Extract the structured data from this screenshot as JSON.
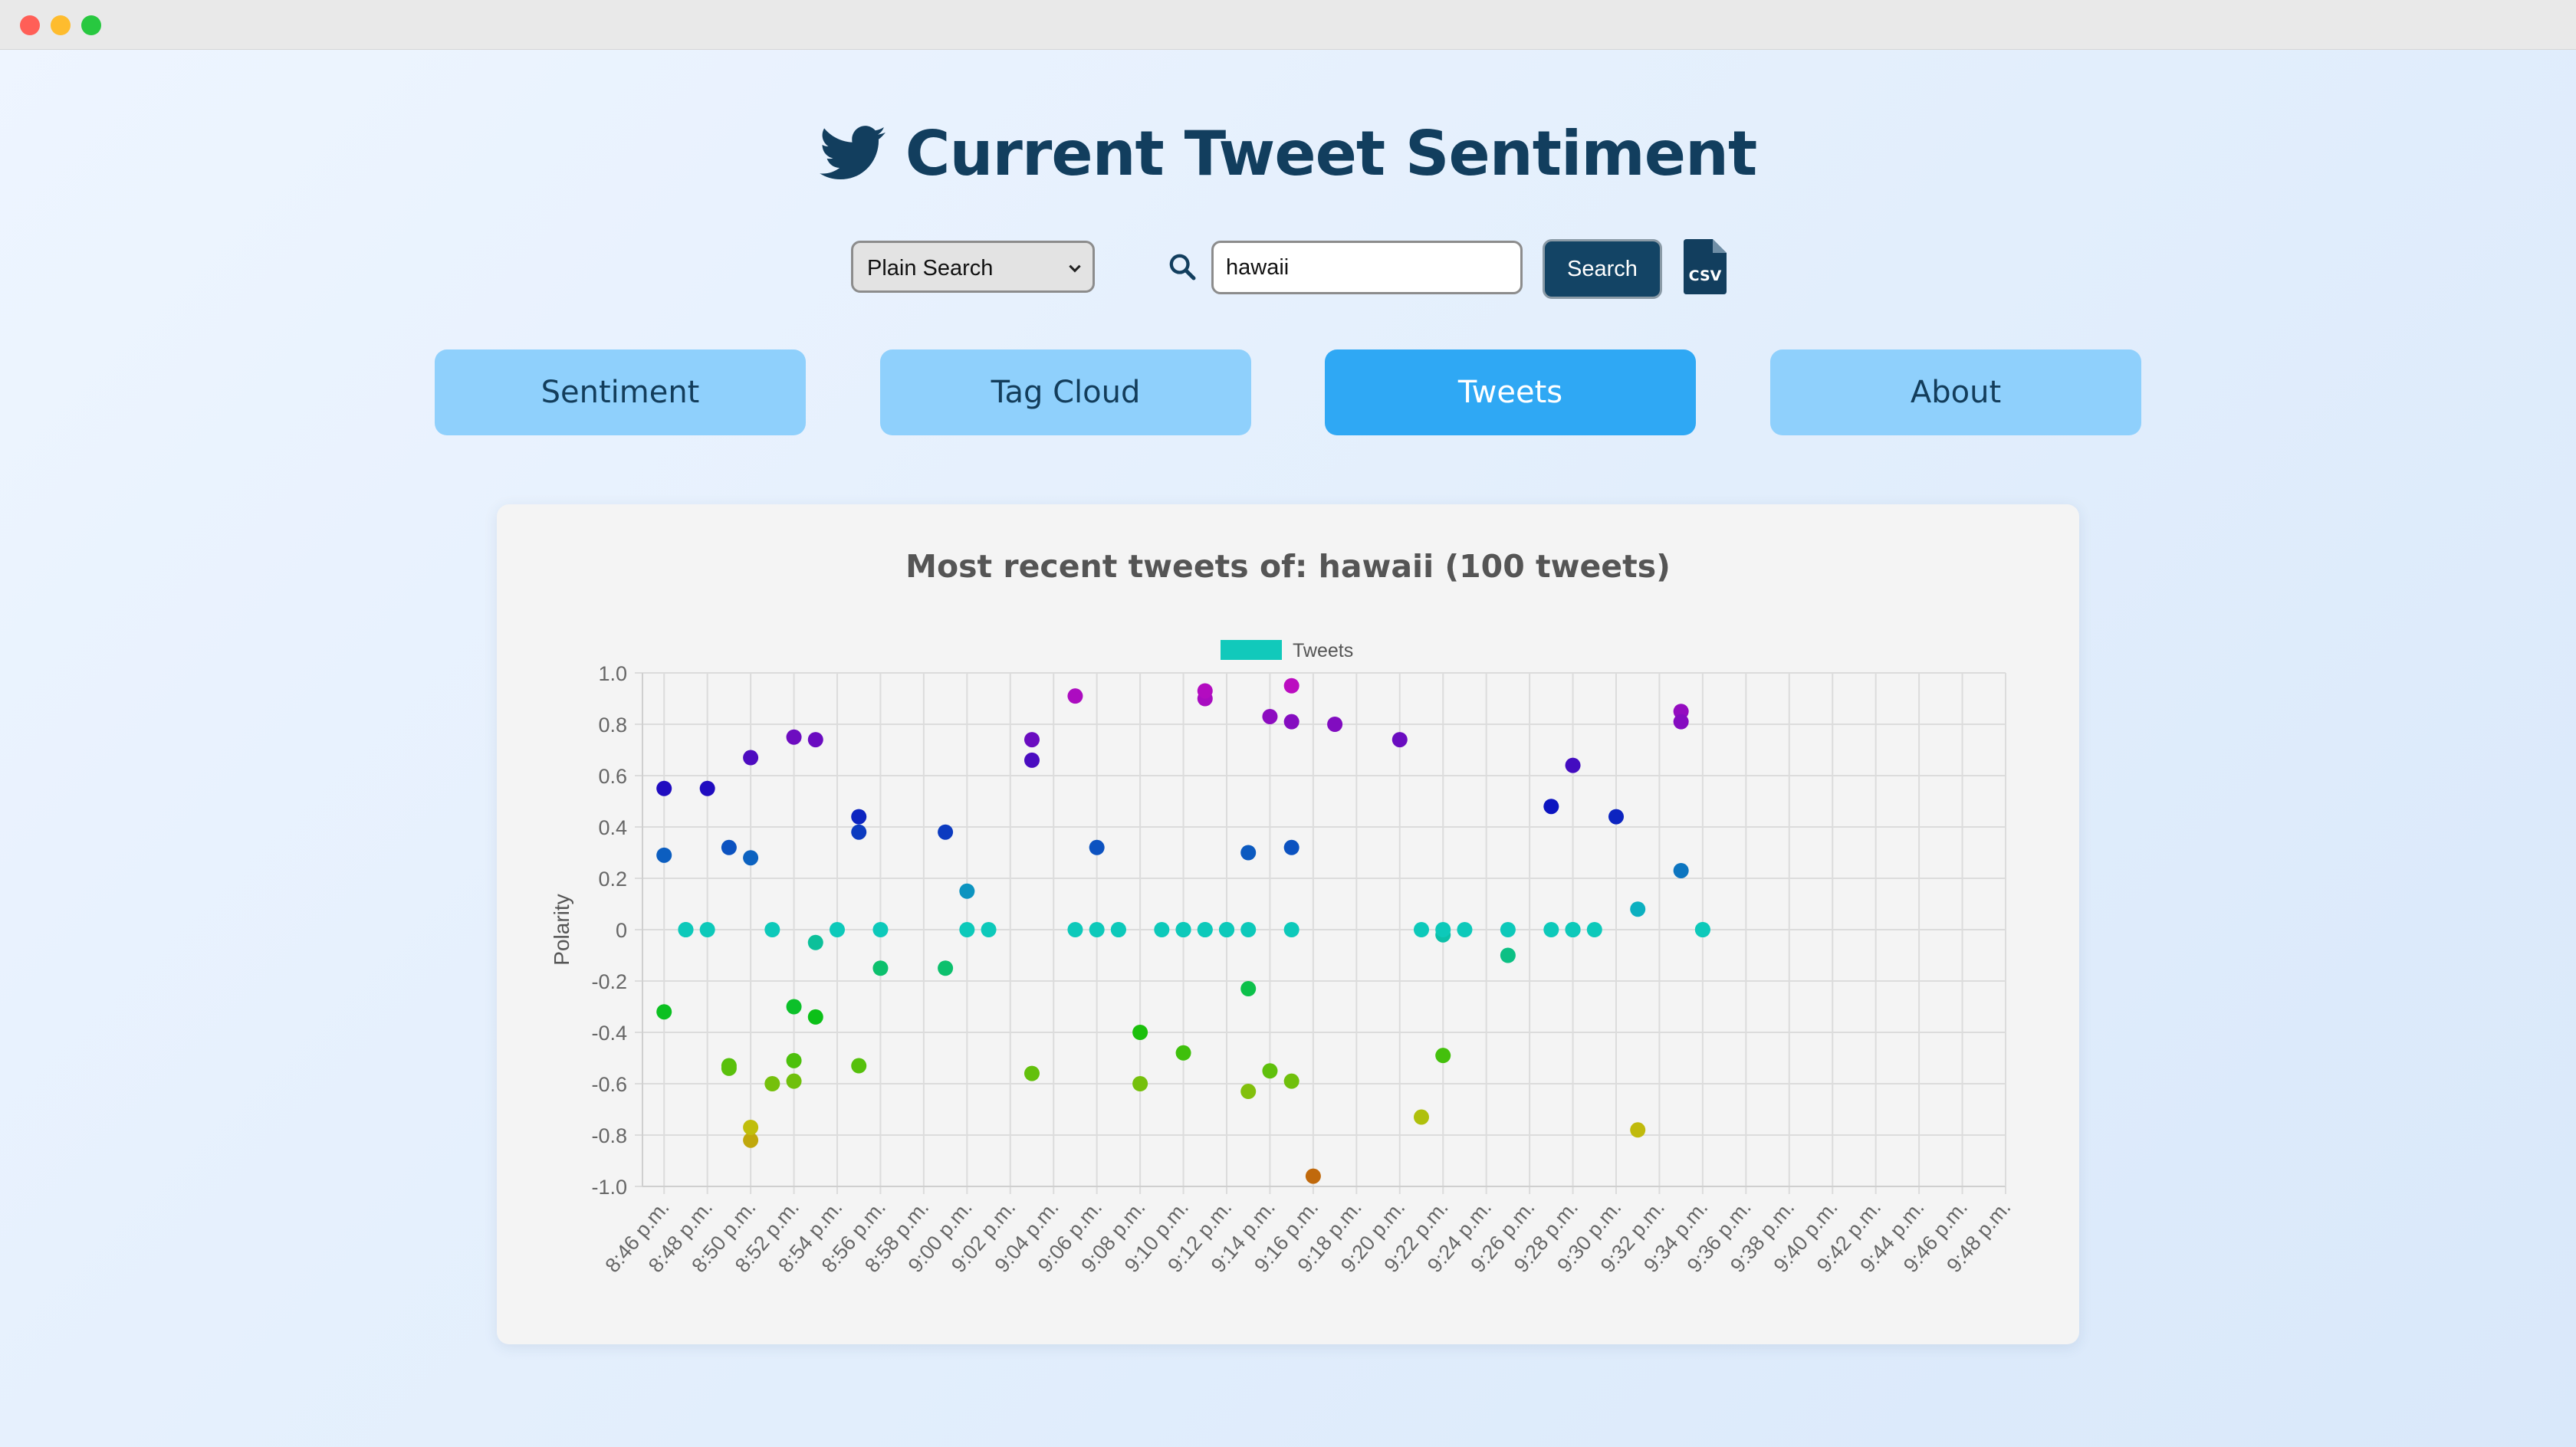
{
  "app": {
    "title": "Current Tweet Sentiment"
  },
  "search": {
    "mode_selected": "Plain Search",
    "query": "hawaii",
    "button_label": "Search",
    "export_icon": "csv-file-icon"
  },
  "nav": {
    "tabs": [
      {
        "label": "Sentiment",
        "active": false
      },
      {
        "label": "Tag Cloud",
        "active": false
      },
      {
        "label": "Tweets",
        "active": true
      },
      {
        "label": "About",
        "active": false
      }
    ]
  },
  "colors": {
    "title": "#123e5e",
    "active_tab": "#2fa8f4",
    "inactive_tab": "#8fd0fc",
    "legend_swatch": "#11c9bb"
  },
  "chart_data": {
    "type": "scatter",
    "title": "Most recent tweets of: hawaii (100 tweets)",
    "legend": [
      "Tweets"
    ],
    "legend_position": "top",
    "ylabel": "Polarity",
    "ylim": [
      -1.0,
      1.0
    ],
    "y_ticks": [
      "1.0",
      "0.8",
      "0.6",
      "0.4",
      "0.2",
      "0",
      "-0.2",
      "-0.4",
      "-0.6",
      "-0.8",
      "-1.0"
    ],
    "x_ticks": [
      "8:46 p.m.",
      "8:48 p.m.",
      "8:50 p.m.",
      "8:52 p.m.",
      "8:54 p.m.",
      "8:56 p.m.",
      "8:58 p.m.",
      "9:00 p.m.",
      "9:02 p.m.",
      "9:04 p.m.",
      "9:06 p.m.",
      "9:08 p.m.",
      "9:10 p.m.",
      "9:12 p.m.",
      "9:14 p.m.",
      "9:16 p.m.",
      "9:18 p.m.",
      "9:20 p.m.",
      "9:22 p.m.",
      "9:24 p.m.",
      "9:26 p.m.",
      "9:28 p.m.",
      "9:30 p.m.",
      "9:32 p.m.",
      "9:34 p.m.",
      "9:36 p.m.",
      "9:38 p.m.",
      "9:40 p.m.",
      "9:42 p.m.",
      "9:44 p.m.",
      "9:46 p.m.",
      "9:48 p.m."
    ],
    "x_range_minutes": [
      "8:45 p.m.",
      "9:48 p.m."
    ],
    "grid": true,
    "series": [
      {
        "name": "Tweets",
        "points": [
          [
            "8:46 p.m.",
            0.55
          ],
          [
            "8:46 p.m.",
            0.29
          ],
          [
            "8:46 p.m.",
            -0.32
          ],
          [
            "8:47 p.m.",
            0
          ],
          [
            "8:47 p.m.",
            0
          ],
          [
            "8:48 p.m.",
            0
          ],
          [
            "8:48 p.m.",
            0.55
          ],
          [
            "8:49 p.m.",
            -0.53
          ],
          [
            "8:49 p.m.",
            -0.54
          ],
          [
            "8:49 p.m.",
            0.32
          ],
          [
            "8:50 p.m.",
            0.28
          ],
          [
            "8:50 p.m.",
            0.67
          ],
          [
            "8:50 p.m.",
            -0.82
          ],
          [
            "8:50 p.m.",
            -0.77
          ],
          [
            "8:51 p.m.",
            0
          ],
          [
            "8:51 p.m.",
            -0.6
          ],
          [
            "8:52 p.m.",
            -0.59
          ],
          [
            "8:52 p.m.",
            -0.3
          ],
          [
            "8:52 p.m.",
            0.75
          ],
          [
            "8:52 p.m.",
            -0.51
          ],
          [
            "8:53 p.m.",
            -0.05
          ],
          [
            "8:53 p.m.",
            -0.34
          ],
          [
            "8:53 p.m.",
            0.74
          ],
          [
            "8:54 p.m.",
            0
          ],
          [
            "8:55 p.m.",
            0.44
          ],
          [
            "8:55 p.m.",
            0.38
          ],
          [
            "8:55 p.m.",
            -0.53
          ],
          [
            "8:56 p.m.",
            0
          ],
          [
            "8:56 p.m.",
            -0.15
          ],
          [
            "8:59 p.m.",
            0.38
          ],
          [
            "8:59 p.m.",
            -0.15
          ],
          [
            "9:00 p.m.",
            0.15
          ],
          [
            "9:00 p.m.",
            0
          ],
          [
            "9:01 p.m.",
            0
          ],
          [
            "9:03 p.m.",
            0.74
          ],
          [
            "9:03 p.m.",
            -0.56
          ],
          [
            "9:03 p.m.",
            0.66
          ],
          [
            "9:05 p.m.",
            0.91
          ],
          [
            "9:05 p.m.",
            0
          ],
          [
            "9:06 p.m.",
            0.32
          ],
          [
            "9:06 p.m.",
            0
          ],
          [
            "9:07 p.m.",
            0
          ],
          [
            "9:07 p.m.",
            0
          ],
          [
            "9:08 p.m.",
            -0.4
          ],
          [
            "9:08 p.m.",
            -0.6
          ],
          [
            "9:09 p.m.",
            0
          ],
          [
            "9:10 p.m.",
            0
          ],
          [
            "9:10 p.m.",
            0
          ],
          [
            "9:10 p.m.",
            -0.48
          ],
          [
            "9:10 p.m.",
            0
          ],
          [
            "9:11 p.m.",
            0
          ],
          [
            "9:11 p.m.",
            0.9
          ],
          [
            "9:11 p.m.",
            0.93
          ],
          [
            "9:11 p.m.",
            0
          ],
          [
            "9:12 p.m.",
            0
          ],
          [
            "9:12 p.m.",
            0
          ],
          [
            "9:12 p.m.",
            0
          ],
          [
            "9:13 p.m.",
            0
          ],
          [
            "9:13 p.m.",
            -0.63
          ],
          [
            "9:13 p.m.",
            -0.23
          ],
          [
            "9:13 p.m.",
            0.3
          ],
          [
            "9:14 p.m.",
            0.83
          ],
          [
            "9:14 p.m.",
            -0.55
          ],
          [
            "9:15 p.m.",
            0.95
          ],
          [
            "9:15 p.m.",
            0.32
          ],
          [
            "9:15 p.m.",
            0
          ],
          [
            "9:15 p.m.",
            -0.59
          ],
          [
            "9:15 p.m.",
            0.81
          ],
          [
            "9:16 p.m.",
            -0.96
          ],
          [
            "9:17 p.m.",
            0.8
          ],
          [
            "9:20 p.m.",
            0.74
          ],
          [
            "9:21 p.m.",
            0
          ],
          [
            "9:21 p.m.",
            -0.73
          ],
          [
            "9:22 p.m.",
            -0.49
          ],
          [
            "9:22 p.m.",
            -0.02
          ],
          [
            "9:22 p.m.",
            0
          ],
          [
            "9:23 p.m.",
            0
          ],
          [
            "9:25 p.m.",
            0
          ],
          [
            "9:25 p.m.",
            -0.1
          ],
          [
            "9:27 p.m.",
            0
          ],
          [
            "9:27 p.m.",
            0.48
          ],
          [
            "9:28 p.m.",
            0
          ],
          [
            "9:28 p.m.",
            0
          ],
          [
            "9:28 p.m.",
            0
          ],
          [
            "9:28 p.m.",
            0.64
          ],
          [
            "9:29 p.m.",
            0
          ],
          [
            "9:30 p.m.",
            0.44
          ],
          [
            "9:31 p.m.",
            -0.78
          ],
          [
            "9:31 p.m.",
            0.08
          ],
          [
            "9:33 p.m.",
            0.85
          ],
          [
            "9:33 p.m.",
            0.81
          ],
          [
            "9:33 p.m.",
            0.23
          ],
          [
            "9:34 p.m.",
            0
          ],
          [
            "9:34 p.m.",
            0
          ]
        ]
      }
    ]
  }
}
